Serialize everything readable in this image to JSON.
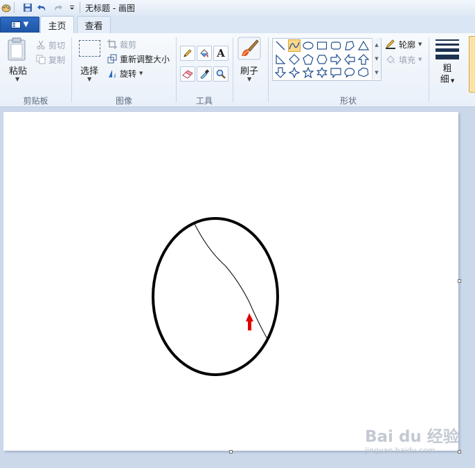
{
  "titlebar": {
    "title": "无标题 - 画图",
    "quick_access": [
      "app-icon",
      "save-icon",
      "undo-icon",
      "redo-icon",
      "customize-icon"
    ]
  },
  "tabs": {
    "file_menu": "file-menu-icon",
    "home": "主页",
    "view": "查看"
  },
  "clipboard": {
    "paste": "粘贴",
    "cut": "剪切",
    "copy": "复制",
    "group": "剪贴板"
  },
  "image": {
    "select": "选择",
    "crop": "裁剪",
    "resize": "重新调整大小",
    "rotate": "旋转",
    "group": "图像"
  },
  "tools": {
    "group": "工具",
    "items": [
      "pencil-icon",
      "fill-icon",
      "text-icon",
      "eraser-icon",
      "color-picker-icon",
      "magnifier-icon"
    ]
  },
  "brushes": {
    "label": "刷子"
  },
  "shapes": {
    "group": "形状",
    "outline": "轮廓",
    "fill": "填充",
    "selected": "curve"
  },
  "size": {
    "label_line1": "粗",
    "label_line2": "细"
  },
  "canvas": {
    "background": "#ffffff",
    "ellipse_stroke": "#000000",
    "arrow_color": "#e00000"
  },
  "watermark": {
    "main": "Bai du 经验",
    "sub": "jingyan.baidu.com"
  },
  "colors": {
    "ribbon_bg": "#eef4fb",
    "workspace_bg": "#cbd8ea",
    "accent": "#2f6dc4"
  }
}
